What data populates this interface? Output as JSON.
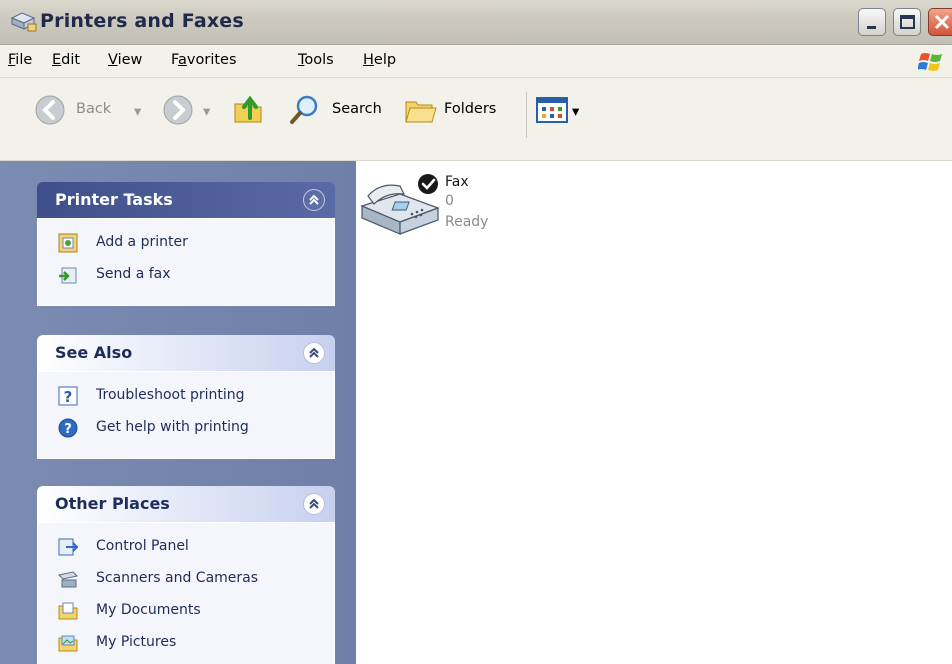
{
  "window": {
    "title": "Printers and Faxes"
  },
  "menu": [
    {
      "label": "File",
      "accel": "F",
      "rest": "ile"
    },
    {
      "label": "Edit",
      "accel": "E",
      "rest": "dit"
    },
    {
      "label": "View",
      "accel": "V",
      "rest": "iew"
    },
    {
      "label": "Favorites",
      "pre": "F",
      "accel": "a",
      "rest": "vorites"
    },
    {
      "label": "Tools",
      "accel": "T",
      "rest": "ools"
    },
    {
      "label": "Help",
      "accel": "H",
      "rest": "elp"
    }
  ],
  "toolbar": {
    "back": "Back",
    "search": "Search",
    "folders": "Folders"
  },
  "sidebar": {
    "printer_tasks": {
      "title": "Printer Tasks",
      "items": [
        "Add a printer",
        "Send a fax"
      ]
    },
    "see_also": {
      "title": "See Also",
      "items": [
        "Troubleshoot printing",
        "Get help with printing"
      ]
    },
    "other_places": {
      "title": "Other Places",
      "items": [
        "Control Panel",
        "Scanners and Cameras",
        "My Documents",
        "My Pictures"
      ]
    }
  },
  "printers": [
    {
      "name": "Fax",
      "jobs": "0",
      "status": "Ready"
    }
  ]
}
